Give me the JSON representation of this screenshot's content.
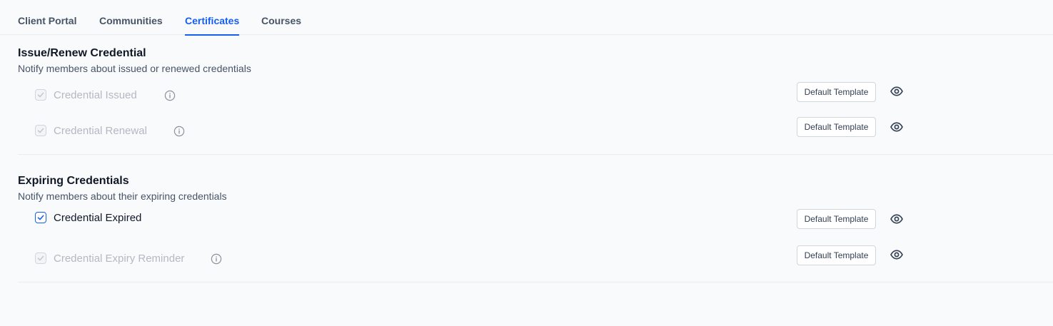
{
  "tabs": [
    {
      "label": "Client Portal",
      "active": false
    },
    {
      "label": "Communities",
      "active": false
    },
    {
      "label": "Certificates",
      "active": true
    },
    {
      "label": "Courses",
      "active": false
    }
  ],
  "sections": [
    {
      "title": "Issue/Renew Credential",
      "description": "Notify members about issued or renewed credentials",
      "rows": [
        {
          "label": "Credential Issued",
          "checked": true,
          "disabled": true,
          "info_icon": "info-icon",
          "template_label": "Default Template",
          "preview_icon": "eye-icon"
        },
        {
          "label": "Credential Renewal",
          "checked": true,
          "disabled": true,
          "info_icon": "info-icon",
          "template_label": "Default Template",
          "preview_icon": "eye-icon"
        }
      ]
    },
    {
      "title": "Expiring Credentials",
      "description": "Notify members about their expiring credentials",
      "rows": [
        {
          "label": "Credential Expired",
          "checked": true,
          "disabled": false,
          "template_label": "Default Template",
          "preview_icon": "eye-icon"
        },
        {
          "label": "Credential Expiry Reminder",
          "checked": true,
          "disabled": true,
          "info_icon": "info-icon",
          "template_label": "Default Template",
          "preview_icon": "eye-icon"
        }
      ]
    }
  ],
  "colors": {
    "accent": "#155eef",
    "background": "#f9fafb",
    "disabled_text": "#b3b8c2",
    "muted_text": "#475467"
  }
}
